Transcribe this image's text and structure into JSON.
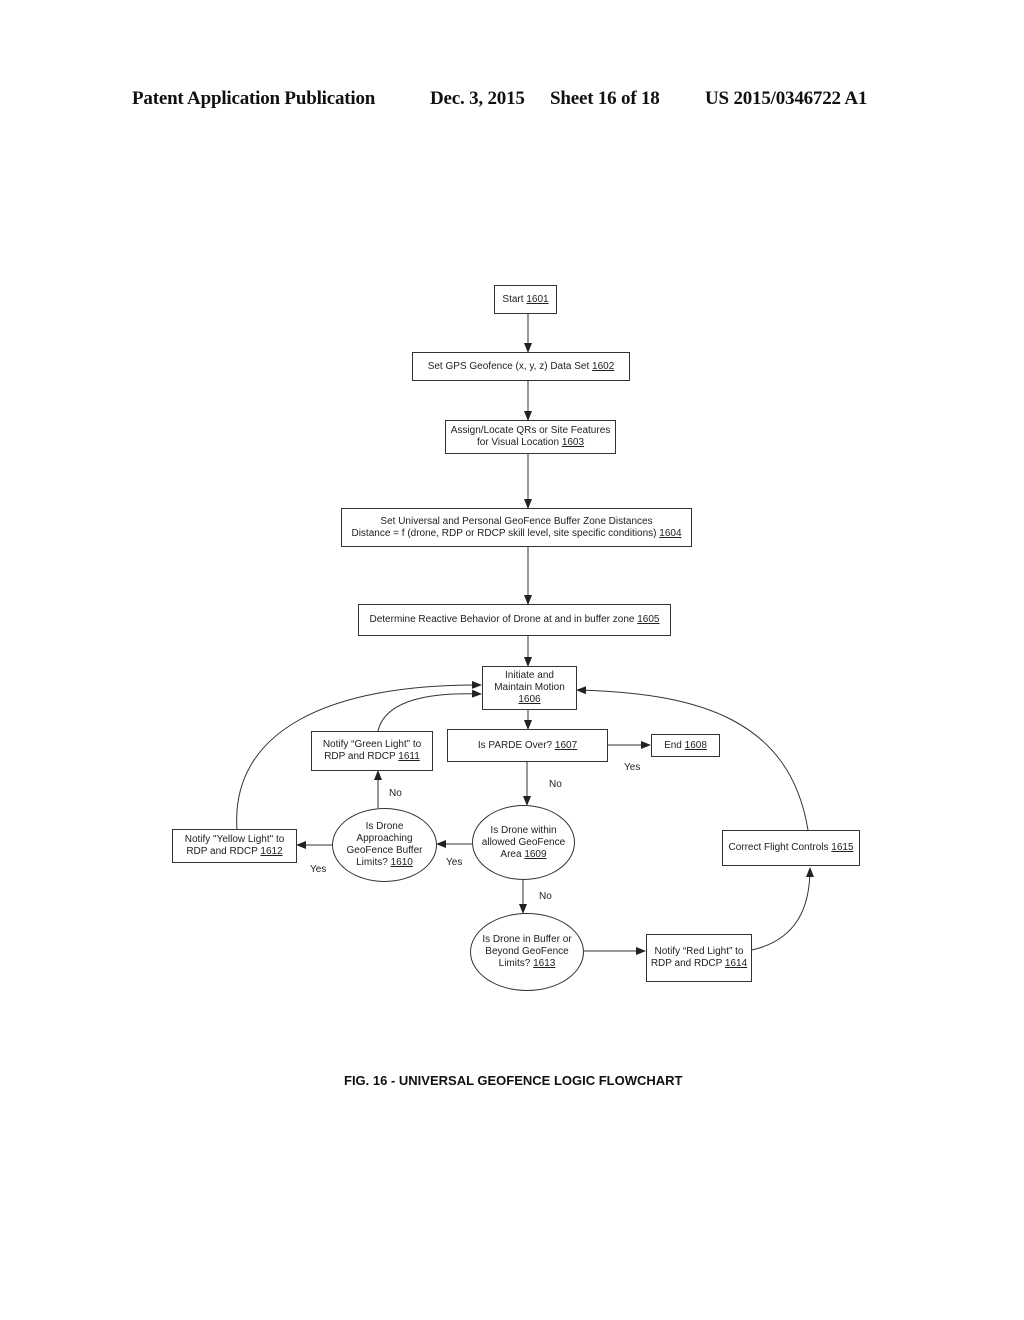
{
  "header": {
    "publication": "Patent Application Publication",
    "date": "Dec. 3, 2015",
    "sheet": "Sheet 16 of 18",
    "number": "US 2015/0346722 A1"
  },
  "caption": "FIG. 16 - UNIVERSAL GEOFENCE LOGIC FLOWCHART",
  "nodes": {
    "n1601": {
      "lines": [
        "Start"
      ],
      "ref": "1601"
    },
    "n1602": {
      "lines": [
        "Set GPS Geofence (x, y, z) Data Set"
      ],
      "ref": "1602"
    },
    "n1603": {
      "lines": [
        "Assign/Locate QRs or Site Features",
        "for Visual Location"
      ],
      "ref": "1603"
    },
    "n1604": {
      "lines": [
        "Set Universal and Personal GeoFence Buffer Zone Distances",
        "Distance = f (drone, RDP or RDCP skill level, site specific conditions)"
      ],
      "ref": "1604"
    },
    "n1605": {
      "lines": [
        "Determine Reactive Behavior of Drone at and in buffer zone"
      ],
      "ref": "1605"
    },
    "n1606": {
      "lines": [
        "Initiate and",
        "Maintain Motion"
      ],
      "ref": "1606"
    },
    "n1607": {
      "lines": [
        "Is PARDE Over?"
      ],
      "ref": "1607"
    },
    "n1608": {
      "lines": [
        "End"
      ],
      "ref": "1608"
    },
    "n1609": {
      "lines": [
        "Is Drone within",
        "allowed GeoFence",
        "Area"
      ],
      "ref": "1609"
    },
    "n1610": {
      "lines": [
        "Is Drone",
        "Approaching",
        "GeoFence Buffer",
        "Limits?"
      ],
      "ref": "1610"
    },
    "n1611": {
      "lines": [
        "Notify “Green Light” to",
        "RDP and RDCP"
      ],
      "ref": "1611"
    },
    "n1612": {
      "lines": [
        "Notify \"Yellow Light\" to",
        "RDP and RDCP"
      ],
      "ref": "1612"
    },
    "n1613": {
      "lines": [
        "Is Drone in Buffer or",
        "Beyond GeoFence",
        "Limits?"
      ],
      "ref": "1613"
    },
    "n1614": {
      "lines": [
        "Notify “Red Light” to",
        "RDP and RDCP"
      ],
      "ref": "1614"
    },
    "n1615": {
      "lines": [
        "Correct Flight Controls"
      ],
      "ref": "1615"
    }
  },
  "edge_labels": {
    "parde_yes": "Yes",
    "parde_no": "No",
    "approach_no": "No",
    "within_yes": "Yes",
    "approach_yes": "Yes",
    "within_no": "No"
  }
}
